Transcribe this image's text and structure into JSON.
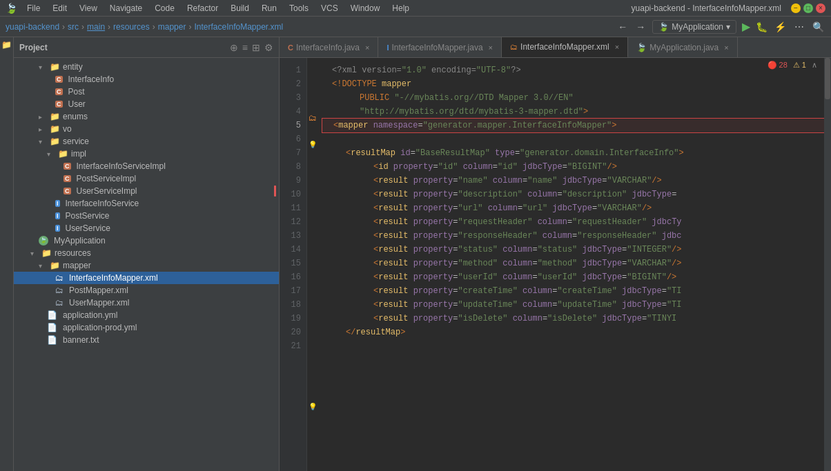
{
  "window": {
    "title": "yuapi-backend - InterfaceInfoMapper.xml",
    "menu_items": [
      "File",
      "Edit",
      "View",
      "Navigate",
      "Code",
      "Refactor",
      "Build",
      "Run",
      "Tools",
      "VCS",
      "Window",
      "Help"
    ]
  },
  "breadcrumb": {
    "items": [
      "yuapi-backend",
      "src",
      "main",
      "resources",
      "mapper",
      "InterfaceInfoMapper.xml"
    ]
  },
  "run_config": "MyApplication",
  "sidebar": {
    "title": "Project",
    "tree": [
      {
        "indent": 2,
        "type": "folder",
        "label": "entity",
        "expanded": true
      },
      {
        "indent": 3,
        "type": "class-c",
        "label": "InterfaceInfo"
      },
      {
        "indent": 3,
        "type": "class-c",
        "label": "Post"
      },
      {
        "indent": 3,
        "type": "class-c",
        "label": "User"
      },
      {
        "indent": 2,
        "type": "folder",
        "label": "enums",
        "expanded": false
      },
      {
        "indent": 2,
        "type": "folder",
        "label": "vo",
        "expanded": false
      },
      {
        "indent": 2,
        "type": "folder",
        "label": "service",
        "expanded": true
      },
      {
        "indent": 3,
        "type": "folder",
        "label": "impl",
        "expanded": true
      },
      {
        "indent": 4,
        "type": "class-c",
        "label": "InterfaceInfoServiceImpl"
      },
      {
        "indent": 4,
        "type": "class-c",
        "label": "PostServiceImpl"
      },
      {
        "indent": 4,
        "type": "class-c",
        "label": "UserServiceImpl"
      },
      {
        "indent": 3,
        "type": "class-i",
        "label": "InterfaceInfoService"
      },
      {
        "indent": 3,
        "type": "class-i",
        "label": "PostService"
      },
      {
        "indent": 3,
        "type": "class-i",
        "label": "UserService"
      },
      {
        "indent": 2,
        "type": "spring",
        "label": "MyApplication"
      },
      {
        "indent": 1,
        "type": "folder",
        "label": "resources",
        "expanded": true
      },
      {
        "indent": 2,
        "type": "folder",
        "label": "mapper",
        "expanded": true
      },
      {
        "indent": 3,
        "type": "xml-selected",
        "label": "InterfaceInfoMapper.xml"
      },
      {
        "indent": 3,
        "type": "xml",
        "label": "PostMapper.xml"
      },
      {
        "indent": 3,
        "type": "xml",
        "label": "UserMapper.xml"
      },
      {
        "indent": 2,
        "type": "yaml",
        "label": "application.yml"
      },
      {
        "indent": 2,
        "type": "yaml",
        "label": "application-prod.yml"
      },
      {
        "indent": 2,
        "type": "txt",
        "label": "banner.txt"
      }
    ]
  },
  "tabs": [
    {
      "label": "InterfaceInfo.java",
      "type": "java",
      "active": false
    },
    {
      "label": "InterfaceInfoMapper.java",
      "type": "java-i",
      "active": false
    },
    {
      "label": "InterfaceInfoMapper.xml",
      "type": "xml",
      "active": true
    },
    {
      "label": "MyApplication.java",
      "type": "java",
      "active": false
    }
  ],
  "code": {
    "lines": [
      {
        "num": 1,
        "content": "<?xml version=\"1.0\" encoding=\"UTF-8\"?>",
        "type": "pi"
      },
      {
        "num": 2,
        "content": "<!DOCTYPE mapper",
        "type": "doctype"
      },
      {
        "num": 3,
        "content": "        PUBLIC \"-//mybatis.org//DTD Mapper 3.0//EN\"",
        "type": "doctype"
      },
      {
        "num": 4,
        "content": "        \"http://mybatis.org/dtd/mybatis-3-mapper.dtd\">",
        "type": "doctype"
      },
      {
        "num": 5,
        "content": "<mapper namespace=\"generator.mapper.InterfaceInfoMapper\">",
        "type": "tag-highlighted"
      },
      {
        "num": 6,
        "content": "",
        "type": "empty"
      },
      {
        "num": 7,
        "content": "    <resultMap id=\"BaseResultMap\" type=\"generator.domain.InterfaceInfo\">",
        "type": "tag"
      },
      {
        "num": 8,
        "content": "            <id property=\"id\" column=\"id\" jdbcType=\"BIGINT\"/>",
        "type": "tag"
      },
      {
        "num": 9,
        "content": "            <result property=\"name\" column=\"name\" jdbcType=\"VARCHAR\"/>",
        "type": "tag"
      },
      {
        "num": 10,
        "content": "            <result property=\"description\" column=\"description\" jdbcType=",
        "type": "tag"
      },
      {
        "num": 11,
        "content": "            <result property=\"url\" column=\"url\" jdbcType=\"VARCHAR\"/>",
        "type": "tag"
      },
      {
        "num": 12,
        "content": "            <result property=\"requestHeader\" column=\"requestHeader\" jdbcTy",
        "type": "tag"
      },
      {
        "num": 13,
        "content": "            <result property=\"responseHeader\" column=\"responseHeader\" jdbc",
        "type": "tag"
      },
      {
        "num": 14,
        "content": "            <result property=\"status\" column=\"status\" jdbcType=\"INTEGER\"/>",
        "type": "tag"
      },
      {
        "num": 15,
        "content": "            <result property=\"method\" column=\"method\" jdbcType=\"VARCHAR\"/>",
        "type": "tag"
      },
      {
        "num": 16,
        "content": "            <result property=\"userId\" column=\"userId\" jdbcType=\"BIGINT\"/>",
        "type": "tag"
      },
      {
        "num": 17,
        "content": "            <result property=\"createTime\" column=\"createTime\" jdbcType=\"TI",
        "type": "tag"
      },
      {
        "num": 18,
        "content": "            <result property=\"updateTime\" column=\"updateTime\" jdbcType=\"TI",
        "type": "tag"
      },
      {
        "num": 19,
        "content": "            <result property=\"isDelete\" column=\"isDelete\" jdbcType=\"TINYI",
        "type": "tag"
      },
      {
        "num": 20,
        "content": "    </resultMap>",
        "type": "tag-close"
      },
      {
        "num": 21,
        "content": "",
        "type": "empty"
      }
    ],
    "errors": {
      "count": 28,
      "warnings": 1
    }
  }
}
